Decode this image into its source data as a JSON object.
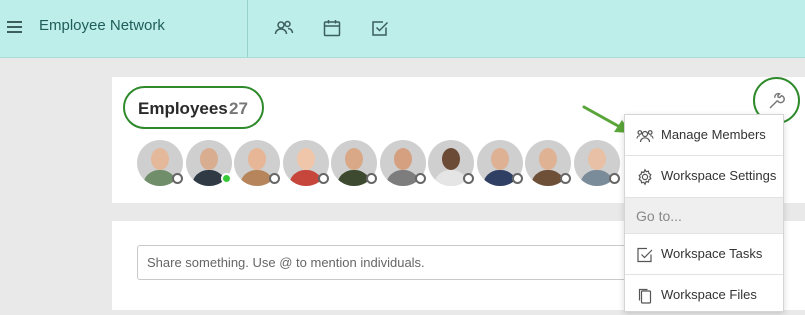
{
  "header": {
    "app_title": "Employee Network",
    "menu_icon": "hamburger-icon",
    "nav_icons": [
      "people-icon",
      "calendar-icon",
      "checkbox-icon"
    ]
  },
  "employees": {
    "title": "Employees",
    "count": "27",
    "settings_icon": "wrench-icon"
  },
  "avatars": [
    {
      "status": "offline",
      "skin": "#e4b89a",
      "cloth": "#6f8e69"
    },
    {
      "status": "online",
      "skin": "#d9ad90",
      "cloth": "#2f3a45"
    },
    {
      "status": "offline",
      "skin": "#e6b696",
      "cloth": "#b7855c"
    },
    {
      "status": "offline",
      "skin": "#f0c6ab",
      "cloth": "#c7463c"
    },
    {
      "status": "offline",
      "skin": "#d8a887",
      "cloth": "#3e4a2f"
    },
    {
      "status": "offline",
      "skin": "#d5a080",
      "cloth": "#7d7d7d"
    },
    {
      "status": "offline",
      "skin": "#6b4a36",
      "cloth": "#e5e5e5"
    },
    {
      "status": "offline",
      "skin": "#deb195",
      "cloth": "#2e3f63"
    },
    {
      "status": "offline",
      "skin": "#e0b294",
      "cloth": "#6e4f37"
    },
    {
      "status": "offline",
      "skin": "#e8c0a5",
      "cloth": "#7a8b9a"
    }
  ],
  "share": {
    "placeholder": "Share something. Use @ to mention individuals."
  },
  "dropdown": {
    "items": [
      {
        "label": "Manage Members",
        "icon": "manage-members-icon"
      },
      {
        "label": "Workspace Settings",
        "icon": "gear-icon"
      }
    ],
    "goto_label": "Go to...",
    "goto_items": [
      {
        "label": "Workspace Tasks",
        "icon": "task-check-icon"
      },
      {
        "label": "Workspace Files",
        "icon": "files-icon"
      }
    ]
  },
  "accent_colors": {
    "header_bg": "#bdeeea",
    "highlight_green": "#2f8a2c",
    "online_green": "#37c837"
  }
}
